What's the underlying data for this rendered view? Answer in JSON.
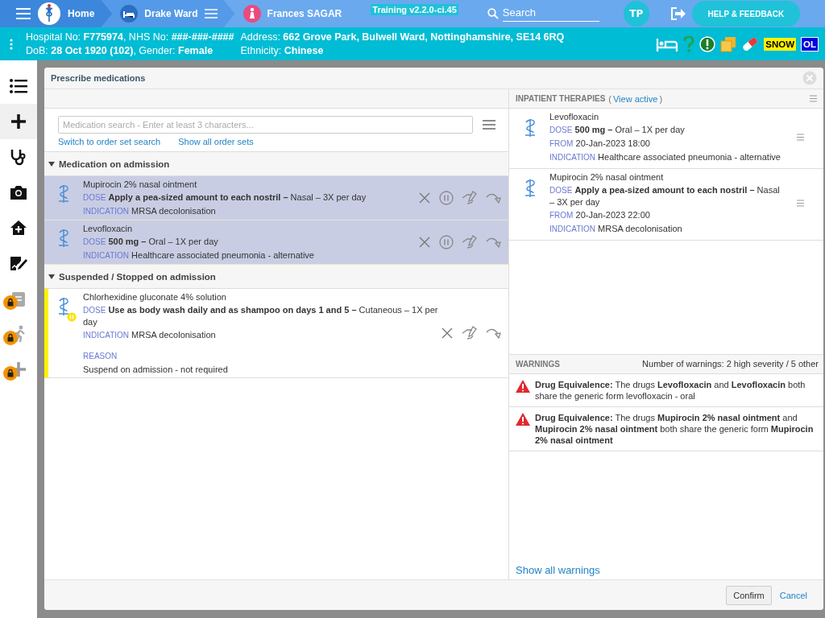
{
  "nav": {
    "home": "Home",
    "ward": "Drake Ward",
    "patient": "Frances SAGAR",
    "version": "Training v2.2.0-ci.45",
    "search_placeholder": "Search",
    "user_initials": "TP",
    "help": "HELP & FEEDBACK"
  },
  "patient_bar": {
    "line_1": "Hospital No: **F775974**, NHS No: **###-###-####**",
    "line_2": "DoB: **28 Oct 1920 (102)**, Gender: **Female**",
    "address": "Address: **662 Grove Park, Bulwell Ward, Nottinghamshire, SE14 6RQ**",
    "ethnicity": "Ethnicity: **Chinese**",
    "badges": [
      {
        "label": "SNOW",
        "kind": "snow"
      },
      {
        "label": "OL",
        "kind": "ol"
      }
    ]
  },
  "sidebar": {
    "items": [
      {
        "kind": "list",
        "selected": false,
        "locked": false
      },
      {
        "kind": "plus",
        "selected": true,
        "locked": false
      },
      {
        "kind": "stethoscope",
        "selected": false,
        "locked": false
      },
      {
        "kind": "camera",
        "selected": false,
        "locked": false
      },
      {
        "kind": "home",
        "selected": false,
        "locked": false
      },
      {
        "kind": "edit",
        "selected": false,
        "locked": false
      },
      {
        "kind": "clipboard",
        "selected": false,
        "locked": true
      },
      {
        "kind": "walk",
        "selected": false,
        "locked": true
      },
      {
        "kind": "plus",
        "selected": false,
        "locked": true
      }
    ]
  },
  "modal": {
    "title": "Prescribe medications",
    "search": {
      "placeholder": "Medication search - Enter at least 3 characters...",
      "links": [
        "Switch to order set search",
        "Show all order sets"
      ]
    },
    "sections": [
      {
        "title": "Medication on admission",
        "expanded": true,
        "items": [
          {
            "name": "Mupirocin 2% nasal ointment",
            "selected": true,
            "suspended": false,
            "fields": [
              {
                "label": "DOSE",
                "value": "**Apply a pea-sized amount to each nostril –** Nasal – 3X per day"
              },
              {
                "label": "INDICATION",
                "value": "MRSA decolonisation"
              }
            ]
          },
          {
            "name": "Levofloxacin",
            "selected": true,
            "suspended": false,
            "fields": [
              {
                "label": "DOSE",
                "value": "**500 mg –** Oral – 1X per day"
              },
              {
                "label": "INDICATION",
                "value": "Healthcare associated pneumonia - alternative"
              }
            ]
          }
        ]
      },
      {
        "title": "Suspended / Stopped on admission",
        "expanded": true,
        "items": [
          {
            "name": "Chlorhexidine gluconate 4% solution",
            "selected": false,
            "suspended": true,
            "fields": [
              {
                "label": "DOSE",
                "value": "**Use as body wash daily and as shampoo on days 1 and 5 –** Cutaneous – 1X per day"
              },
              {
                "label": "INDICATION",
                "value": "MRSA decolonisation"
              }
            ],
            "reason_label": "REASON",
            "reason": "Suspend on admission - not required"
          }
        ]
      }
    ],
    "therapies": {
      "title": "INPATIENT THERAPIES",
      "link_open": "(",
      "link": "View active",
      "link_close": ")",
      "items": [
        {
          "name": "Levofloxacin",
          "fields": [
            {
              "label": "DOSE",
              "value": "**500 mg –** Oral – 1X per day"
            },
            {
              "label": "FROM",
              "value": "20-Jan-2023 18:00"
            },
            {
              "label": "INDICATION",
              "value": "Healthcare associated pneumonia - alternative"
            }
          ]
        },
        {
          "name": "Mupirocin 2% nasal ointment",
          "fields": [
            {
              "label": "DOSE",
              "value": "**Apply a pea-sized amount to each nostril –** Nasal – 3X per day"
            },
            {
              "label": "FROM",
              "value": "20-Jan-2023 22:00"
            },
            {
              "label": "INDICATION",
              "value": "MRSA decolonisation"
            }
          ]
        }
      ]
    },
    "warnings": {
      "title": "WARNINGS",
      "summary": "Number of warnings: 2 high severity / 5 other",
      "items": [
        {
          "text": "**Drug Equivalence:** The drugs **Levofloxacin** and **Levofloxacin** both share the generic form levofloxacin - oral"
        },
        {
          "text": "**Drug Equivalence:** The drugs **Mupirocin 2% nasal ointment** and **Mupirocin 2% nasal ointment** both share the generic form **Mupirocin 2% nasal ointment**"
        }
      ],
      "show_all": "Show all warnings"
    },
    "buttons": {
      "confirm": "Confirm",
      "cancel": "Cancel"
    }
  }
}
